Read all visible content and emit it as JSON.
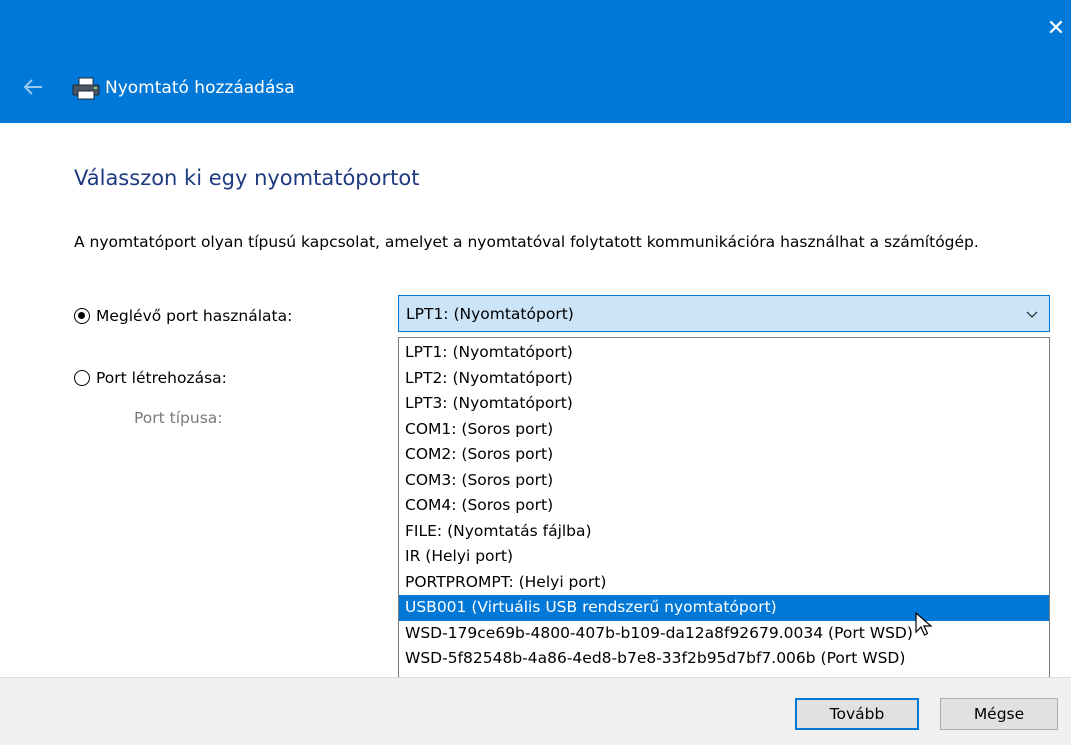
{
  "window": {
    "title": "Nyomtató hozzáadása",
    "close_glyph": "✕",
    "accent_color": "#0078d7"
  },
  "page": {
    "heading": "Válasszon ki egy nyomtatóportot",
    "description": "A nyomtatóport olyan típusú kapcsolat, amelyet a nyomtatóval folytatott kommunikációra használhat a számítógép."
  },
  "options": {
    "existing_port_label": "Meglévő port használata:",
    "create_port_label": "Port létrehozása:",
    "port_type_label": "Port típusa:",
    "existing_selected": true
  },
  "combo": {
    "value": "LPT1: (Nyomtatóport)"
  },
  "dropdown": {
    "items": [
      "LPT1: (Nyomtatóport)",
      "LPT2: (Nyomtatóport)",
      "LPT3: (Nyomtatóport)",
      "COM1: (Soros port)",
      "COM2: (Soros port)",
      "COM3: (Soros port)",
      "COM4: (Soros port)",
      "FILE: (Nyomtatás fájlba)",
      "IR (Helyi port)",
      "PORTPROMPT: (Helyi port)",
      "USB001 (Virtuális USB rendszerű nyomtatóport)",
      "WSD-179ce69b-4800-407b-b109-da12a8f92679.0034 (Port WSD)",
      "WSD-5f82548b-4a86-4ed8-b7e8-33f2b95d7bf7.006b (Port WSD)"
    ],
    "highlighted_index": 10
  },
  "buttons": {
    "next": "Tovább",
    "cancel": "Mégse"
  },
  "icons": {
    "back": "back-arrow-icon",
    "printer": "printer-icon",
    "close": "close-icon",
    "chevron": "chevron-down-icon",
    "cursor": "mouse-pointer-icon"
  }
}
